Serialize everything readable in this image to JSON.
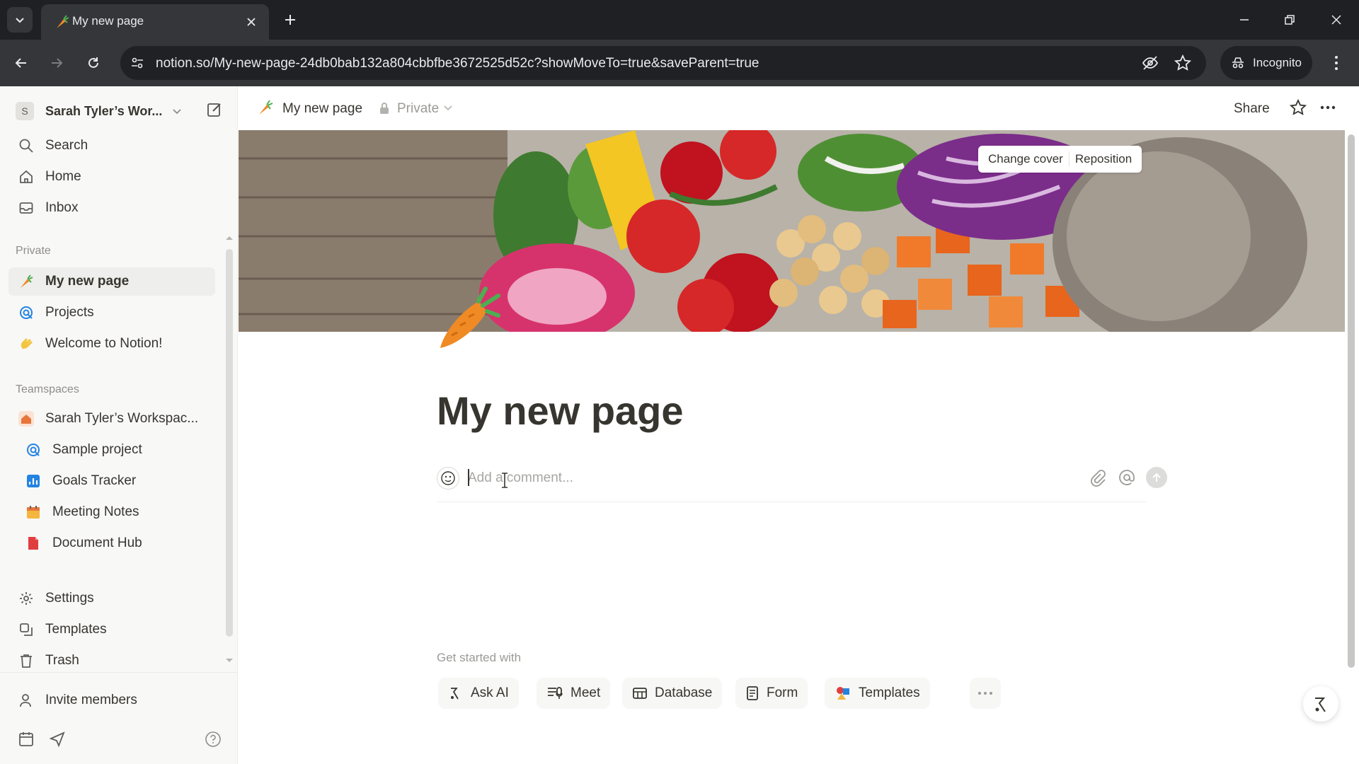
{
  "browser": {
    "tab_title": "My new page",
    "url": "notion.so/My-new-page-24db0bab132a804cbbfbe3672525d52c?showMoveTo=true&saveParent=true",
    "profile_label": "Incognito"
  },
  "sidebar": {
    "workspace_initial": "S",
    "workspace_name": "Sarah Tyler’s Wor...",
    "nav": [
      {
        "label": "Search",
        "icon": "search-icon"
      },
      {
        "label": "Home",
        "icon": "home-icon"
      },
      {
        "label": "Inbox",
        "icon": "inbox-icon"
      }
    ],
    "private_section_label": "Private",
    "private_items": [
      {
        "label": "My new page",
        "icon": "carrot-icon",
        "active": true
      },
      {
        "label": "Projects",
        "icon": "target-icon"
      },
      {
        "label": "Welcome to Notion!",
        "icon": "wave-icon"
      }
    ],
    "teamspaces_section_label": "Teamspaces",
    "teamspace_name": "Sarah Tyler’s Workspac...",
    "teamspace_items": [
      {
        "label": "Sample project",
        "icon": "target-icon"
      },
      {
        "label": "Goals Tracker",
        "icon": "chart-icon"
      },
      {
        "label": "Meeting Notes",
        "icon": "calendar-icon"
      },
      {
        "label": "Document Hub",
        "icon": "document-icon"
      }
    ],
    "footer_items": [
      {
        "label": "Settings",
        "icon": "gear-icon"
      },
      {
        "label": "Templates",
        "icon": "templates-icon"
      },
      {
        "label": "Trash",
        "icon": "trash-icon"
      }
    ],
    "invite_label": "Invite members"
  },
  "page": {
    "breadcrumb_title": "My new page",
    "privacy_label": "Private",
    "share_label": "Share",
    "cover_change_label": "Change cover",
    "cover_reposition_label": "Reposition",
    "title": "My new page",
    "comment_placeholder": "Add a comment...",
    "get_started_label": "Get started with",
    "get_started_buttons": [
      {
        "label": "Ask AI",
        "icon": "ai-icon"
      },
      {
        "label": "Meet",
        "icon": "meet-icon"
      },
      {
        "label": "Database",
        "icon": "table-icon"
      },
      {
        "label": "Form",
        "icon": "form-icon"
      },
      {
        "label": "Templates",
        "icon": "templates-color-icon"
      }
    ]
  },
  "colors": {
    "sidebar_bg": "#f8f8f7",
    "chrome_dark": "#1f2023",
    "chrome_toolbar": "#35363a",
    "text": "#37352f",
    "muted": "#9b9a97"
  }
}
